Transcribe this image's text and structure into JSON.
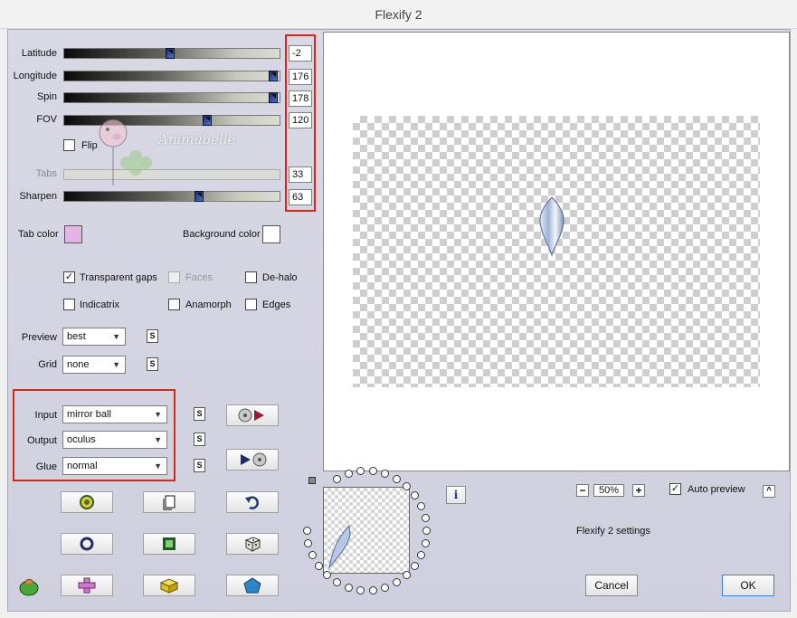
{
  "window": {
    "title": "Flexify 2"
  },
  "sliders": {
    "latitude": {
      "label": "Latitude",
      "value": "-2",
      "fill": 0.49
    },
    "longitude": {
      "label": "Longitude",
      "value": "176",
      "fill": 0.99
    },
    "spin": {
      "label": "Spin",
      "value": "178",
      "fill": 0.99
    },
    "fov": {
      "label": "FOV",
      "value": "120",
      "fill": 0.67
    },
    "tabs": {
      "label": "Tabs",
      "value": "33",
      "fill": 0.0
    },
    "sharpen": {
      "label": "Sharpen",
      "value": "63",
      "fill": 0.63
    }
  },
  "flip": {
    "label": "Flip",
    "checked": false
  },
  "colors": {
    "tab_color_label": "Tab color",
    "tab_color": "#e2b5e4",
    "background_color_label": "Background color",
    "background_color": "#ffffff"
  },
  "options": {
    "transparent_gaps": {
      "label": "Transparent gaps",
      "checked": true,
      "mark": "✓"
    },
    "faces": {
      "label": "Faces",
      "checked": false
    },
    "de_halo": {
      "label": "De-halo",
      "checked": false
    },
    "indicatrix": {
      "label": "Indicatrix",
      "checked": false
    },
    "anamorph": {
      "label": "Anamorph",
      "checked": false
    },
    "edges": {
      "label": "Edges",
      "checked": false
    }
  },
  "dropdowns": {
    "preview": {
      "label": "Preview",
      "value": "best"
    },
    "grid": {
      "label": "Grid",
      "value": "none"
    },
    "input": {
      "label": "Input",
      "value": "mirror ball"
    },
    "output": {
      "label": "Output",
      "value": "oculus"
    },
    "glue": {
      "label": "Glue",
      "value": "normal"
    }
  },
  "small_button_label": "S",
  "watermark_text": "Animabelle",
  "zoom": {
    "minus": "−",
    "value": "50%",
    "plus": "+"
  },
  "auto_preview": {
    "label": "Auto preview",
    "checked": true,
    "mark": "✓"
  },
  "collapse_label": "^",
  "info_label": "i",
  "status_text": "Flexify 2 settings",
  "buttons": {
    "cancel": "Cancel",
    "ok": "OK"
  },
  "accent_colors": {
    "highlight_box": "#d6281a",
    "thumb": "#2a4c9c",
    "panel": "#d4d5e2"
  }
}
